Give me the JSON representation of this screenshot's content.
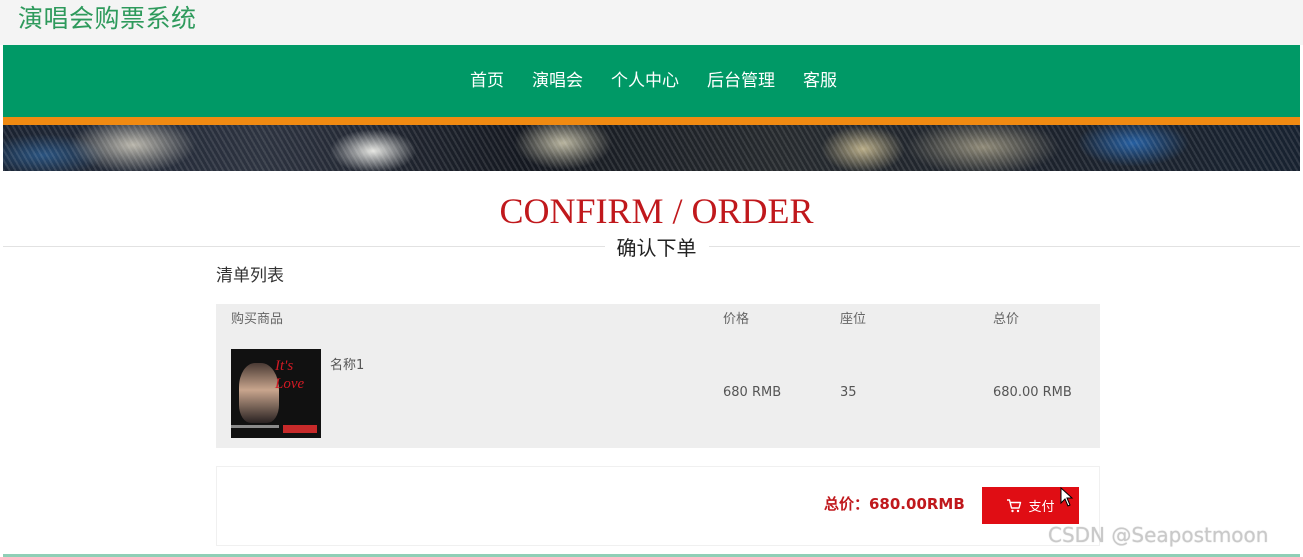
{
  "site": {
    "title": "演唱会购票系统"
  },
  "nav": {
    "items": [
      "首页",
      "演唱会",
      "个人中心",
      "后台管理",
      "客服"
    ]
  },
  "section": {
    "title_en": "CONFIRM / ORDER",
    "title_cn": "确认下单"
  },
  "list": {
    "heading": "清单列表",
    "headers": {
      "product": "购买商品",
      "price": "价格",
      "seat": "座位",
      "total": "总价"
    },
    "rows": [
      {
        "name": "名称1",
        "price": "680 RMB",
        "seat": "35",
        "total": "680.00 RMB",
        "image_icon": "concert-poster"
      }
    ]
  },
  "summary": {
    "total_label": "总价：680.00RMB",
    "pay_label": "支付",
    "pay_icon": "cart-icon"
  },
  "watermark": "CSDN @Seapostmoon",
  "colors": {
    "brand_green": "#009966",
    "title_green": "#2e9a5c",
    "accent_orange": "#f08a12",
    "accent_red": "#c0181c",
    "button_red": "#e00d14"
  }
}
